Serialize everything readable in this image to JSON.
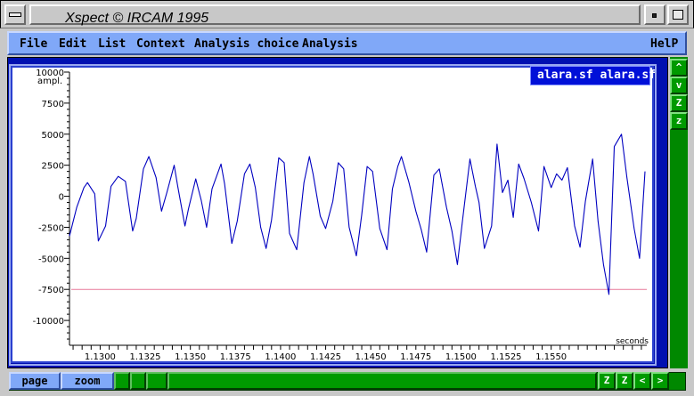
{
  "window": {
    "title": "Xspect  © IRCAM 1995"
  },
  "menubar": {
    "items": [
      {
        "id": "file",
        "label": "File"
      },
      {
        "id": "edit",
        "label": "Edit"
      },
      {
        "id": "list",
        "label": "List"
      },
      {
        "id": "context",
        "label": "Context"
      },
      {
        "id": "analysis-choice",
        "label": "Analysis choice"
      },
      {
        "id": "analysis",
        "label": "Analysis"
      }
    ],
    "help_label": "HelP"
  },
  "plot": {
    "file_tag": "alara.sf alara.sf"
  },
  "side_buttons": [
    "^",
    "v",
    "Z",
    "z"
  ],
  "bottom": {
    "page_label": "page",
    "zoom_label": "zoom",
    "nav": [
      "Z",
      "Z",
      "<",
      ">"
    ]
  },
  "colors": {
    "waveform": "#0000c0",
    "threshold": "#e87898",
    "frame": "#0010b0",
    "menubar": "#80a8f8",
    "controls": "#009a00"
  },
  "chart_data": {
    "type": "line",
    "title": "",
    "xlabel": "seconds",
    "ylabel": "ampl.",
    "xlim": [
      1.1283,
      1.1603
    ],
    "ylim": [
      -12000,
      10000
    ],
    "yticks": [
      10000,
      7500,
      5000,
      2500,
      0,
      -2500,
      -5000,
      -7500,
      -10000
    ],
    "ytick_labels": [
      "10000",
      "7500",
      "5000",
      "2500",
      "0",
      "-2500",
      "-5000",
      "-7500",
      "-10000"
    ],
    "xticks": [
      1.13,
      1.1325,
      1.135,
      1.1375,
      1.14,
      1.1425,
      1.145,
      1.1475,
      1.15,
      1.1525,
      1.155
    ],
    "xtick_labels": [
      "1.1300",
      "1.1325",
      "1.1350",
      "1.1375",
      "1.1400",
      "1.1425",
      "1.1450",
      "1.1475",
      "1.1500",
      "1.1525",
      "1.1550"
    ],
    "threshold": {
      "y": -7500,
      "x_range": [
        1.1284,
        1.1603
      ]
    },
    "series": [
      {
        "x": [
          1.1283,
          1.1287,
          1.1291,
          1.1293,
          1.1297,
          1.1299,
          1.1303,
          1.1306,
          1.131,
          1.1314,
          1.1318,
          1.132,
          1.1324,
          1.1327,
          1.1331,
          1.1334,
          1.1337,
          1.1341,
          1.1343,
          1.1347,
          1.1349,
          1.1353,
          1.1356,
          1.1359,
          1.1362,
          1.1367,
          1.1369,
          1.1373,
          1.1376,
          1.138,
          1.1383,
          1.1386,
          1.1389,
          1.1392,
          1.1395,
          1.1399,
          1.1402,
          1.1405,
          1.1409,
          1.1413,
          1.1416,
          1.1418,
          1.1422,
          1.1425,
          1.1429,
          1.1432,
          1.1435,
          1.1438,
          1.1442,
          1.1445,
          1.1448,
          1.1451,
          1.1455,
          1.1459,
          1.1462,
          1.1465,
          1.1467,
          1.1471,
          1.1475,
          1.1478,
          1.1481,
          1.1485,
          1.1488,
          1.1492,
          1.1495,
          1.1498,
          1.1501,
          1.1505,
          1.1508,
          1.151,
          1.1513,
          1.1517,
          1.152,
          1.1523,
          1.1526,
          1.1529,
          1.1532,
          1.1535,
          1.1539,
          1.1543,
          1.1546,
          1.155,
          1.1553,
          1.1556,
          1.1559,
          1.1563,
          1.1566,
          1.1569,
          1.1573,
          1.1576,
          1.1579,
          1.1582,
          1.1585,
          1.1589,
          1.1592,
          1.1596,
          1.1599,
          1.1602
        ],
        "y": [
          -3200,
          -900,
          700,
          1100,
          200,
          -3600,
          -2400,
          800,
          1600,
          1200,
          -2800,
          -1800,
          2200,
          3200,
          1500,
          -1200,
          300,
          2500,
          800,
          -2400,
          -1000,
          1400,
          -300,
          -2500,
          600,
          2600,
          1000,
          -3800,
          -2000,
          1800,
          2600,
          700,
          -2500,
          -4200,
          -1900,
          3100,
          2700,
          -3000,
          -4300,
          1100,
          3200,
          1800,
          -1600,
          -2600,
          -400,
          2700,
          2200,
          -2500,
          -4800,
          -1500,
          2400,
          2000,
          -2600,
          -4300,
          600,
          2400,
          3200,
          1200,
          -1200,
          -2700,
          -4500,
          1700,
          2200,
          -900,
          -2800,
          -5500,
          -1800,
          3000,
          800,
          -500,
          -4200,
          -2400,
          4200,
          300,
          1300,
          -1700,
          2600,
          1400,
          -500,
          -2800,
          2400,
          700,
          1800,
          1300,
          2300,
          -2400,
          -4100,
          -400,
          3000,
          -2000,
          -5500,
          -7900,
          4000,
          5000,
          1500,
          -2600,
          -5000,
          2000
        ]
      }
    ]
  }
}
